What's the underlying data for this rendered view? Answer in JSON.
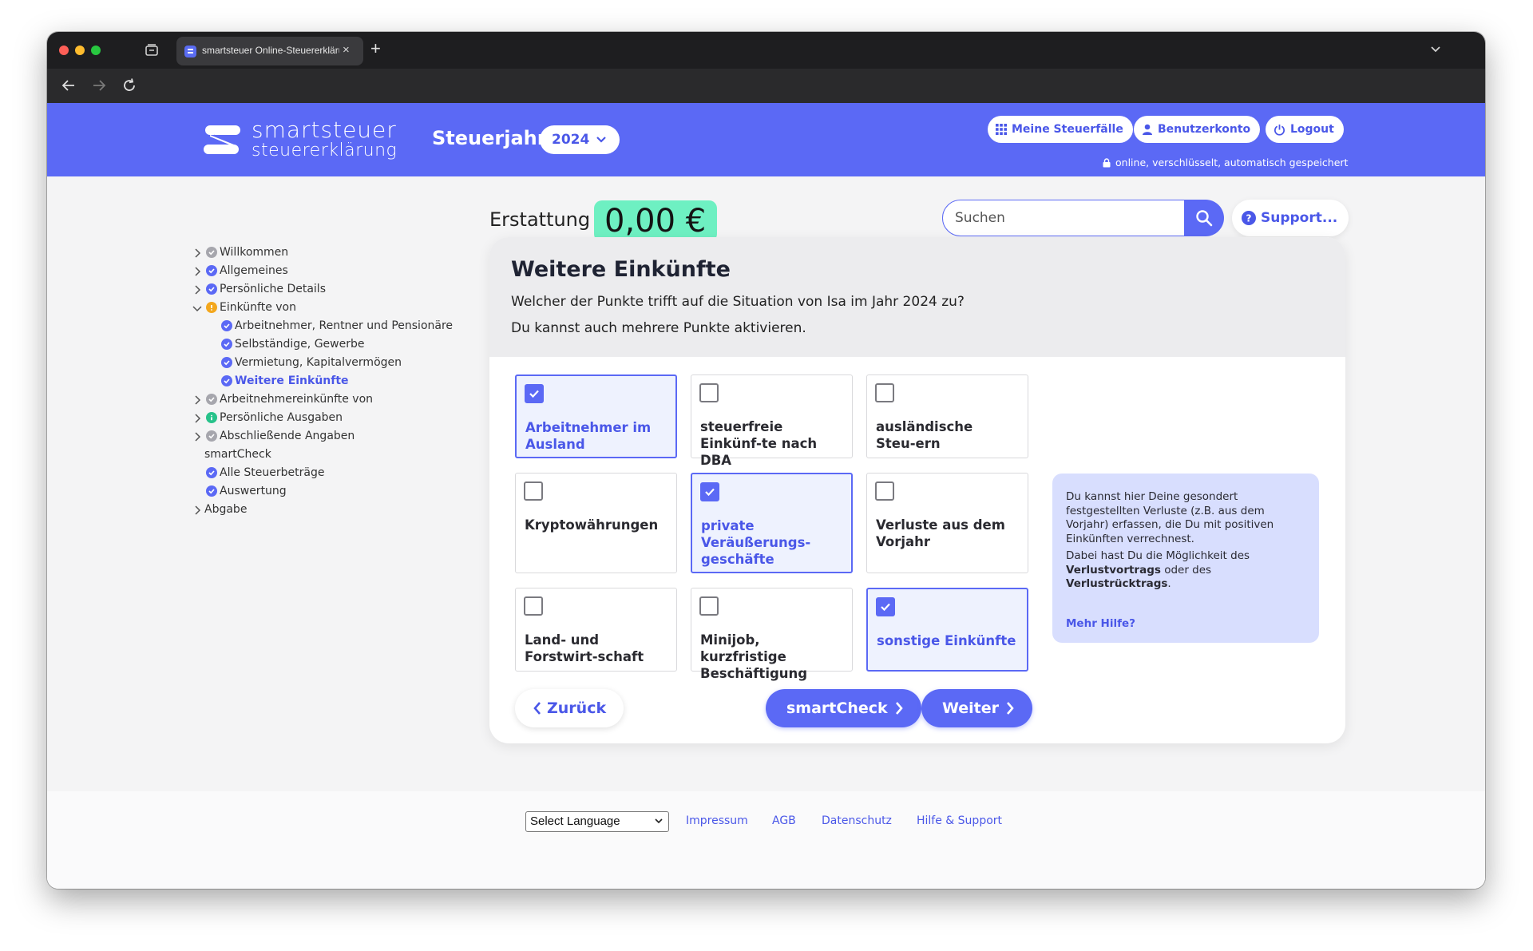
{
  "browser": {
    "tab_title": "smartsteuer Online-Steuererklärung",
    "tab_close": "×",
    "new_tab": "+"
  },
  "header": {
    "brand_line1": "smartsteuer",
    "brand_line2": "steuererklärung",
    "year_label": "Steuerjahr",
    "year_value": "2024",
    "buttons": {
      "cases": "Meine Steuerfälle",
      "account": "Benutzerkonto",
      "logout": "Logout"
    },
    "secure_note": "online, verschlüsselt, automatisch gespeichert"
  },
  "refund": {
    "label": "Erstattung",
    "value": "0,00 €"
  },
  "search": {
    "placeholder": "Suchen"
  },
  "support": {
    "label": "Support..."
  },
  "sidebar": {
    "items": [
      {
        "label": "Willkommen",
        "status": "gray"
      },
      {
        "label": "Allgemeines",
        "status": "done"
      },
      {
        "label": "Persönliche Details",
        "status": "done"
      },
      {
        "label": "Einkünfte von",
        "status": "warning"
      },
      {
        "label": "Arbeitnehmer, Rentner und Pensionäre",
        "status": "done"
      },
      {
        "label": "Selbständige, Gewerbe",
        "status": "done"
      },
      {
        "label": "Vermietung, Kapitalvermögen",
        "status": "done"
      },
      {
        "label": "Weitere Einkünfte",
        "status": "done",
        "active": true
      },
      {
        "label": "Arbeitnehmereinkünfte von",
        "status": "gray"
      },
      {
        "label": "Persönliche Ausgaben",
        "status": "info"
      },
      {
        "label": "Abschließende Angaben",
        "status": "gray"
      },
      {
        "label": "smartCheck"
      },
      {
        "label": "Alle Steuerbeträge",
        "status": "done"
      },
      {
        "label": "Auswertung",
        "status": "done"
      },
      {
        "label": "Abgabe"
      }
    ]
  },
  "main": {
    "title": "Weitere Einkünfte",
    "question": "Welcher der Punkte trifft auf die Situation von Isa im Jahr 2024 zu?",
    "hint": "Du kannst auch mehrere Punkte aktivieren.",
    "options": [
      {
        "label": "Arbeitnehmer im Ausland",
        "checked": true
      },
      {
        "label": "steuerfreie Einkünf-te nach DBA",
        "checked": false
      },
      {
        "label": "ausländische Steu-ern",
        "checked": false
      },
      {
        "label": "Kryptowährungen",
        "checked": false
      },
      {
        "label": "private Veräußerungs-geschäfte",
        "checked": true
      },
      {
        "label": "Verluste aus dem Vorjahr",
        "checked": false
      },
      {
        "label": "Land- und Forstwirt-schaft",
        "checked": false
      },
      {
        "label": "Minijob, kurzfristige Beschäftigung",
        "checked": false
      },
      {
        "label": "sonstige Einkünfte",
        "checked": true
      }
    ],
    "help": {
      "p1": "Du kannst hier Deine gesondert festgestellten Verluste (z.B. aus dem Vorjahr) erfassen, die Du mit positiven Einkünften verrechnest.",
      "p2_a": "Dabei hast Du die Möglichkeit des ",
      "p2_b": "Verlustvortrags",
      "p2_c": " oder des ",
      "p2_d": "Verlustrücktrags",
      "p2_e": ".",
      "link": "Mehr Hilfe?"
    },
    "buttons": {
      "back": "Zurück",
      "smartcheck": "smartCheck",
      "next": "Weiter"
    }
  },
  "footer": {
    "language_select": "Select Language",
    "links": [
      "Impressum",
      "AGB",
      "Datenschutz",
      "Hilfe & Support"
    ]
  },
  "colors": {
    "brand": "#5b69f5",
    "refund_bg": "#6ef0c2",
    "help_bg": "#d8defe",
    "selected_bg": "#eef2fe"
  }
}
